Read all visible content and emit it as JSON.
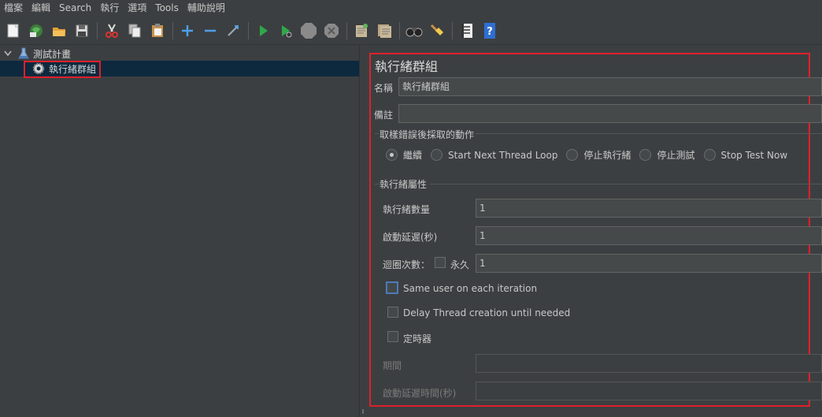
{
  "menu": [
    "檔案",
    "編輯",
    "Search",
    "執行",
    "選項",
    "Tools",
    "輔助說明"
  ],
  "toolbar": {
    "icons": [
      "new-icon",
      "templates-icon",
      "open-icon",
      "save-icon",
      "cut-icon",
      "copy-icon",
      "paste-icon",
      "expand-icon",
      "collapse-icon",
      "toggle-icon",
      "start-icon",
      "start-no-pause-icon",
      "stop-icon",
      "shutdown-icon",
      "clear-icon",
      "clear-all-icon",
      "search-icon",
      "reset-search-icon",
      "function-helper-icon",
      "help-icon"
    ]
  },
  "tree": {
    "root_label": "測試計畫",
    "child_label": "執行緒群組"
  },
  "panel": {
    "title": "執行緒群組",
    "name_label": "名稱",
    "name_value": "執行緒群組",
    "comment_label": "備註",
    "comment_value": "",
    "sampler_error_title": "取樣錯誤後採取的動作",
    "actions": [
      "繼續",
      "Start Next Thread Loop",
      "停止執行緒",
      "停止測試",
      "Stop Test Now"
    ],
    "selected_action": "繼續",
    "thread_props_title": "執行緒屬性",
    "threads_label": "執行緒數量",
    "threads_value": "1",
    "rampup_label": "啟動延遲(秒)",
    "rampup_value": "1",
    "loop_label": "迴圈次數：",
    "forever_label": "永久",
    "loop_value": "1",
    "same_user_label": "Same user on each iteration",
    "delay_label": "Delay Thread creation until needed",
    "scheduler_label": "定時器",
    "duration_label": "期間",
    "startup_delay_label": "啟動延遲時間(秒)"
  }
}
